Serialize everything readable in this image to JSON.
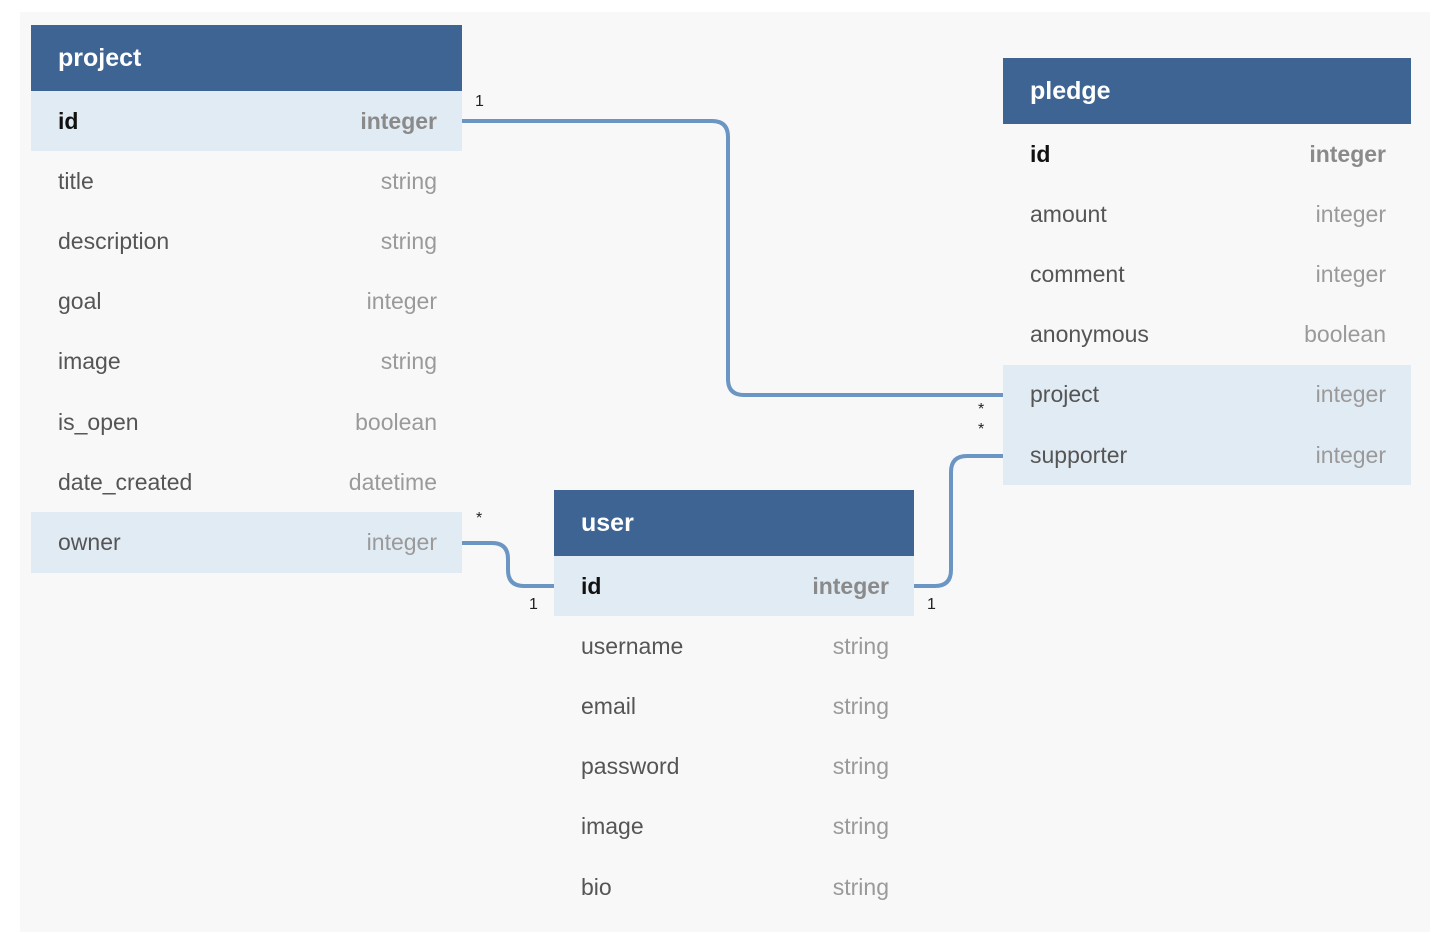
{
  "tables": {
    "project": {
      "name": "project",
      "fields": [
        {
          "name": "id",
          "type": "integer"
        },
        {
          "name": "title",
          "type": "string"
        },
        {
          "name": "description",
          "type": "string"
        },
        {
          "name": "goal",
          "type": "integer"
        },
        {
          "name": "image",
          "type": "string"
        },
        {
          "name": "is_open",
          "type": "boolean"
        },
        {
          "name": "date_created",
          "type": "datetime"
        },
        {
          "name": "owner",
          "type": "integer"
        }
      ]
    },
    "user": {
      "name": "user",
      "fields": [
        {
          "name": "id",
          "type": "integer"
        },
        {
          "name": "username",
          "type": "string"
        },
        {
          "name": "email",
          "type": "string"
        },
        {
          "name": "password",
          "type": "string"
        },
        {
          "name": "image",
          "type": "string"
        },
        {
          "name": "bio",
          "type": "string"
        }
      ]
    },
    "pledge": {
      "name": "pledge",
      "fields": [
        {
          "name": "id",
          "type": "integer"
        },
        {
          "name": "amount",
          "type": "integer"
        },
        {
          "name": "comment",
          "type": "integer"
        },
        {
          "name": "anonymous",
          "type": "boolean"
        },
        {
          "name": "project",
          "type": "integer"
        },
        {
          "name": "supporter",
          "type": "integer"
        }
      ]
    }
  },
  "relations": {
    "project_pledge": {
      "one": "1",
      "many": "*"
    },
    "owner_user": {
      "one": "1",
      "many": "*"
    },
    "user_supporter": {
      "one": "1",
      "many": "*"
    }
  },
  "colors": {
    "header": "#3e6494",
    "key_row": "#e1ebf4",
    "link": "#6b96c4"
  }
}
